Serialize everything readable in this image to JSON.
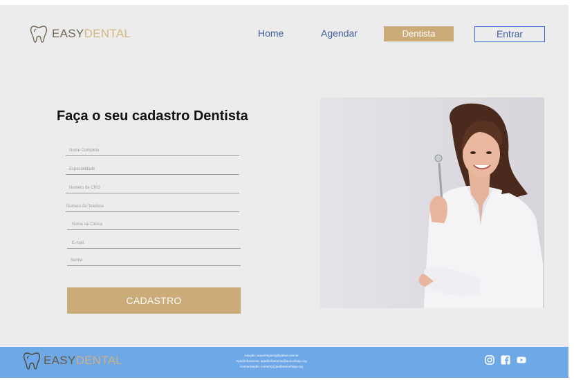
{
  "brand": {
    "part1": "EASY",
    "part2": "DENTAL"
  },
  "nav": {
    "home": "Home",
    "agendar": "Agendar",
    "dentista": "Dentista",
    "entrar": "Entrar"
  },
  "form": {
    "title": "Faça o seu cadastro Dentista",
    "fields": [
      "Nome Completo",
      "Especialidade",
      "Numero de CRO",
      "Numero de Telefone",
      "Nome da Clinica",
      "E-mail",
      "Senha"
    ],
    "submit": "CADASTRO"
  },
  "footer": {
    "contacts": [
      "Adoção: acaochegoorg@yahoo.com.br",
      "Apadrinhamento: apadrinhamento@acaochego.org",
      "Comunicação: comunicacao@acaochego.org"
    ],
    "social_icons": [
      "instagram-icon",
      "facebook-icon",
      "youtube-icon"
    ]
  },
  "colors": {
    "gold": "#cbac79",
    "nav_blue": "#3d5f9e",
    "footer_blue": "#6ea8e6",
    "background": "#ececec"
  }
}
